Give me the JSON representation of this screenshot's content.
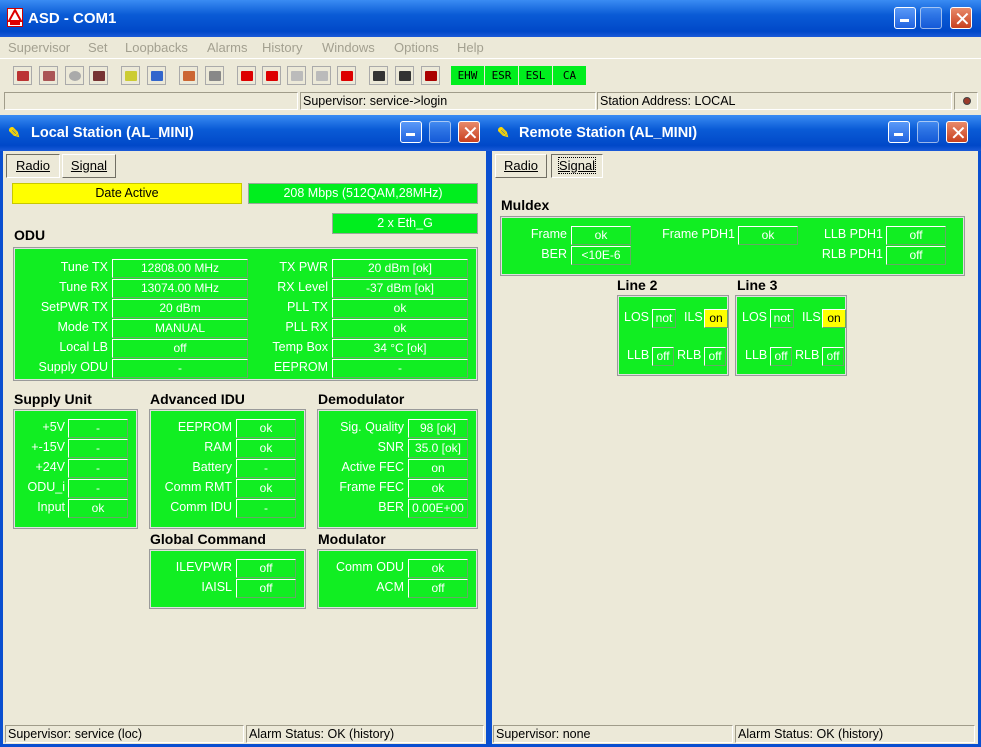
{
  "app": {
    "title": "ASD - COM1"
  },
  "menu": [
    "Supervisor",
    "Set",
    "Loopbacks",
    "Alarms",
    "History",
    "Windows",
    "Options",
    "Help"
  ],
  "toolbar": {
    "indicators": [
      "EHW",
      "ESR",
      "ESL",
      "CA"
    ],
    "icons": [
      "disconnect-icon",
      "connect-icon",
      "stop-icon",
      "save-icon",
      "wand-icon",
      "wand2-icon",
      "tools-icon",
      "speaker-icon",
      "alarm1-icon",
      "alarm2-icon",
      "alarm3-icon",
      "alarm4-icon",
      "alarm5-icon",
      "equalizer-icon",
      "grid-icon",
      "bar-chart-icon"
    ]
  },
  "status": {
    "supervisor": "Supervisor: service->login",
    "station": "Station Address: LOCAL"
  },
  "local": {
    "title": "Local Station (AL_MINI)",
    "tabs": [
      "Radio",
      "Signal"
    ],
    "date_active": "Date Active",
    "rate": "208 Mbps (512QAM,28MHz)",
    "eth": "2 x Eth_G",
    "odu": {
      "title": "ODU",
      "left": [
        [
          "Tune TX",
          "12808.00 MHz"
        ],
        [
          "Tune RX",
          "13074.00 MHz"
        ],
        [
          "SetPWR TX",
          "20 dBm"
        ],
        [
          "Mode TX",
          "MANUAL"
        ],
        [
          "Local LB",
          "off"
        ],
        [
          "Supply ODU",
          "-"
        ]
      ],
      "right": [
        [
          "TX PWR",
          "20 dBm [ok]"
        ],
        [
          "RX Level",
          "-37 dBm [ok]"
        ],
        [
          "PLL TX",
          "ok"
        ],
        [
          "PLL RX",
          "ok"
        ],
        [
          "Temp Box",
          "34 °C [ok]"
        ],
        [
          "EEPROM",
          "-"
        ]
      ]
    },
    "supply": {
      "title": "Supply Unit",
      "rows": [
        [
          "+5V",
          "-"
        ],
        [
          "+-15V",
          "-"
        ],
        [
          "+24V",
          "-"
        ],
        [
          "ODU_i",
          "-"
        ],
        [
          "Input",
          "ok"
        ]
      ]
    },
    "adv": {
      "title": "Advanced IDU",
      "rows": [
        [
          "EEPROM",
          "ok"
        ],
        [
          "RAM",
          "ok"
        ],
        [
          "Battery",
          "-"
        ],
        [
          "Comm RMT",
          "ok"
        ],
        [
          "Comm IDU",
          "-"
        ]
      ]
    },
    "demod": {
      "title": "Demodulator",
      "rows": [
        [
          "Sig. Quality",
          "98 [ok]"
        ],
        [
          "SNR",
          "35.0 [ok]"
        ],
        [
          "Active FEC",
          "on"
        ],
        [
          "Frame FEC",
          "ok"
        ],
        [
          "BER",
          "0.00E+00"
        ]
      ]
    },
    "global": {
      "title": "Global Command",
      "rows": [
        [
          "ILEVPWR",
          "off"
        ],
        [
          "IAISL",
          "off"
        ]
      ]
    },
    "mod": {
      "title": "Modulator",
      "rows": [
        [
          "Comm ODU",
          "ok"
        ],
        [
          "ACM",
          "off"
        ]
      ]
    },
    "status_left": "Supervisor: service (loc)",
    "status_right": "Alarm Status: OK (history)"
  },
  "remote": {
    "title": "Remote Station (AL_MINI)",
    "tabs": [
      "Radio",
      "Signal"
    ],
    "muldex": {
      "title": "Muldex",
      "frame_lbl": "Frame",
      "frame_val": "ok",
      "ber_lbl": "BER",
      "ber_val": "<10E-6",
      "fpdh_lbl": "Frame PDH1",
      "fpdh_val": "ok",
      "llb_lbl": "LLB PDH1",
      "llb_val": "off",
      "rlb_lbl": "RLB PDH1",
      "rlb_val": "off"
    },
    "line2": {
      "title": "Line 2",
      "los": "LOS",
      "los_val": "not",
      "ils": "ILS",
      "ils_val": "on",
      "llb": "LLB",
      "llb_val": "off",
      "rlb": "RLB",
      "rlb_val": "off"
    },
    "line3": {
      "title": "Line 3",
      "los": "LOS",
      "los_val": "not",
      "ils": "ILS",
      "ils_val": "on",
      "llb": "LLB",
      "llb_val": "off",
      "rlb": "RLB",
      "rlb_val": "off"
    },
    "status_left": "Supervisor: none",
    "status_right": "Alarm Status: OK (history)"
  },
  "colors": {
    "panel_green": "#11ee22",
    "title_blue": "#0a5bd6",
    "highlight_yellow": "#ffff00"
  }
}
